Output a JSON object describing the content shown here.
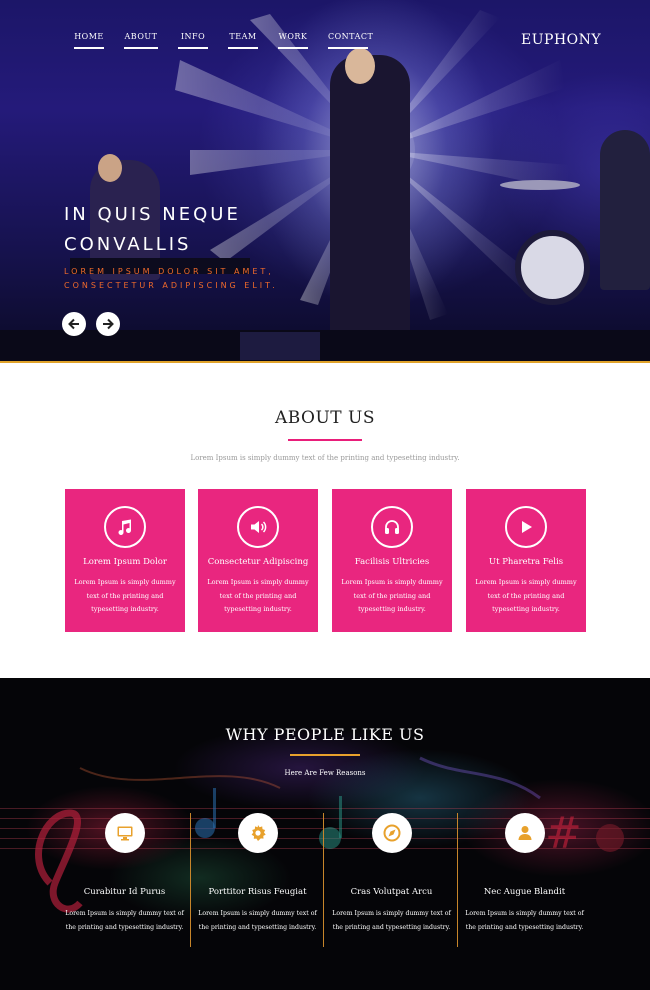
{
  "nav": {
    "items": [
      {
        "label": "HOME"
      },
      {
        "label": "ABOUT"
      },
      {
        "label": "INFO"
      },
      {
        "label": "TEAM"
      },
      {
        "label": "WORK"
      },
      {
        "label": "CONTACT"
      }
    ],
    "brand": "EUPHONY"
  },
  "hero": {
    "title": "IN QUIS NEQUE CONVALLIS",
    "subtitle": "LOREM IPSUM DOLOR SIT AMET, CONSECTETUR ADIPISCING ELIT.",
    "prev_icon": "arrow-left-icon",
    "next_icon": "arrow-right-icon"
  },
  "about": {
    "title": "ABOUT US",
    "lead": "Lorem Ipsum is simply dummy text of the printing and typesetting industry.",
    "cards": [
      {
        "icon": "music-note-icon",
        "title": "Lorem Ipsum Dolor",
        "desc": "Lorem Ipsum is simply dummy text of the printing and typesetting industry."
      },
      {
        "icon": "volume-icon",
        "title": "Consectetur Adipiscing",
        "desc": "Lorem Ipsum is simply dummy text of the printing and typesetting industry."
      },
      {
        "icon": "headphones-icon",
        "title": "Facilisis Ultricies",
        "desc": "Lorem Ipsum is simply dummy text of the printing and typesetting industry."
      },
      {
        "icon": "play-icon",
        "title": "Ut Pharetra Felis",
        "desc": "Lorem Ipsum is simply dummy text of the printing and typesetting industry."
      }
    ],
    "accent": "#e9267f"
  },
  "why": {
    "title": "WHY PEOPLE LIKE US",
    "subtitle": "Here Are Few Reasons",
    "items": [
      {
        "icon": "monitor-icon",
        "title": "Curabitur Id Purus",
        "desc": "Lorem Ipsum is simply dummy text of the printing and typesetting industry."
      },
      {
        "icon": "gear-icon",
        "title": "Porttitor Risus Feugiat",
        "desc": "Lorem Ipsum is simply dummy text of the printing and typesetting industry."
      },
      {
        "icon": "compass-icon",
        "title": "Cras Volutpat Arcu",
        "desc": "Lorem Ipsum is simply dummy text of the printing and typesetting industry."
      },
      {
        "icon": "user-icon",
        "title": "Nec Augue Blandit",
        "desc": "Lorem Ipsum is simply dummy text of the printing and typesetting industry."
      }
    ],
    "accent": "#e8a12c"
  }
}
